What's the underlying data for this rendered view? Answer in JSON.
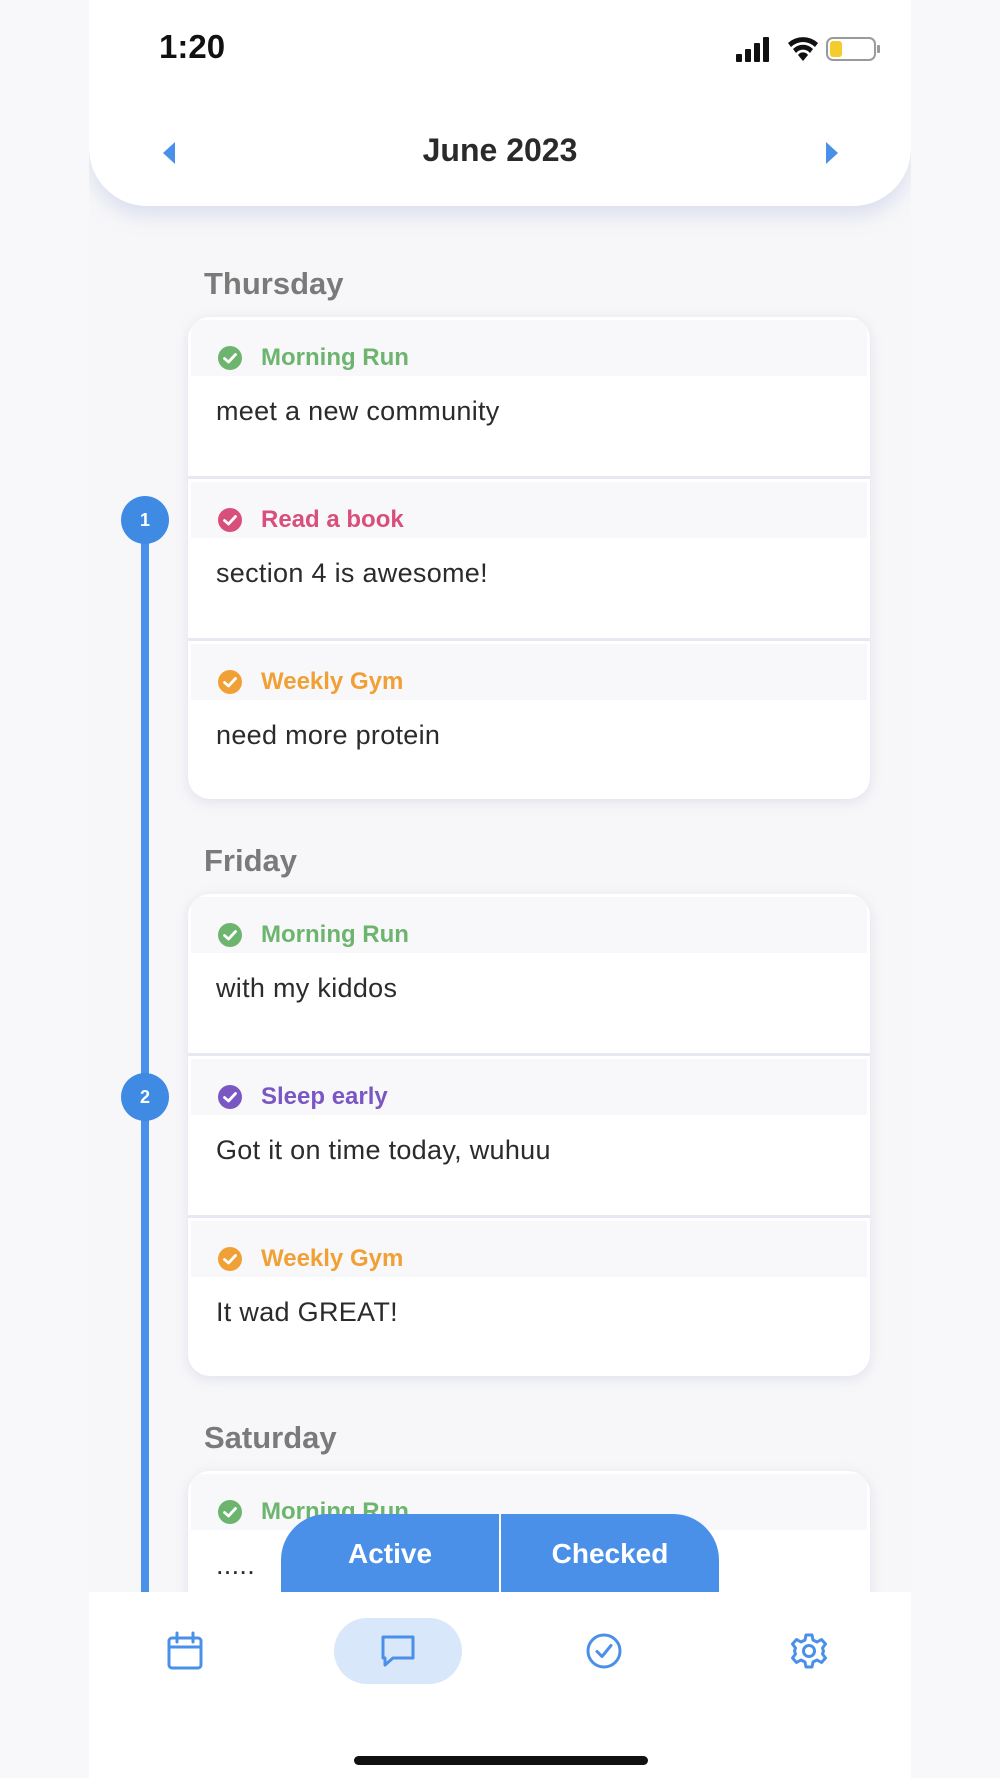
{
  "status_bar": {
    "time": "1:20"
  },
  "header": {
    "month": "June 2023"
  },
  "colors": {
    "accent": "#4a90e8",
    "green": "#6db56f",
    "pink": "#d94f7b",
    "orange": "#f0a035",
    "purple": "#7b57c4"
  },
  "timeline": {
    "steps": [
      "1",
      "2"
    ]
  },
  "days": [
    {
      "label": "Thursday",
      "entries": [
        {
          "habit": "Morning Run",
          "note": "meet a new community",
          "color": "#6db56f"
        },
        {
          "habit": "Read a book",
          "note": "section 4 is awesome!",
          "color": "#d94f7b"
        },
        {
          "habit": "Weekly Gym",
          "note": "need more protein",
          "color": "#f0a035"
        }
      ]
    },
    {
      "label": "Friday",
      "entries": [
        {
          "habit": "Morning Run",
          "note": "with my kiddos",
          "color": "#6db56f"
        },
        {
          "habit": "Sleep early",
          "note": "Got it on time today, wuhuu",
          "color": "#7b57c4"
        },
        {
          "habit": "Weekly Gym",
          "note": "It wad GREAT!",
          "color": "#f0a035"
        }
      ]
    },
    {
      "label": "Saturday",
      "entries": [
        {
          "habit": "Morning Run",
          "note": ".....",
          "color": "#6db56f"
        }
      ]
    }
  ],
  "segmented": {
    "active_label": "Active",
    "checked_label": "Checked"
  },
  "bottom_nav": {
    "items": [
      "calendar-icon",
      "chat-icon",
      "check-circle-icon",
      "settings-icon"
    ],
    "active": "chat-icon"
  }
}
